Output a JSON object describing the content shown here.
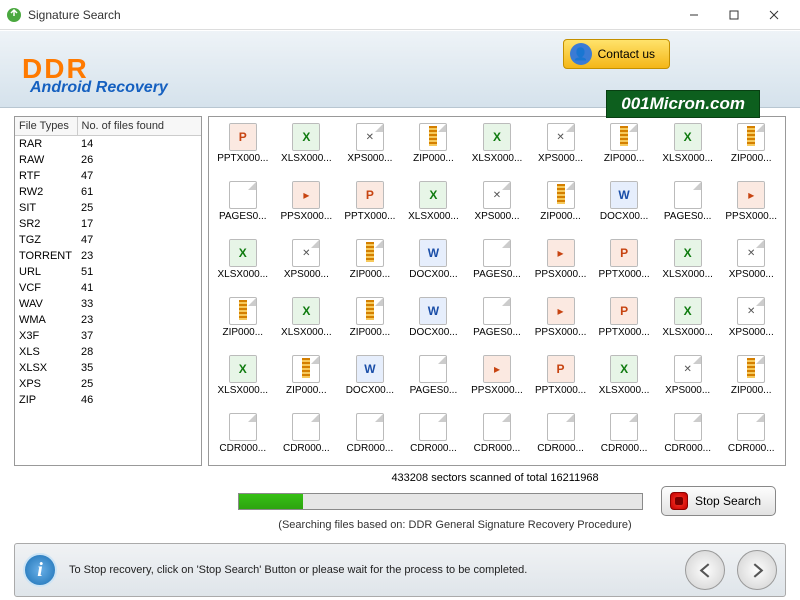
{
  "window": {
    "title": "Signature Search"
  },
  "header": {
    "brand": "DDR",
    "subtitle": "Android Recovery",
    "contact_label": "Contact us"
  },
  "watermark": "001Micron.com",
  "file_types": {
    "header_type": "File Types",
    "header_count": "No. of files found",
    "rows": [
      {
        "type": "RAR",
        "count": 14
      },
      {
        "type": "RAW",
        "count": 26
      },
      {
        "type": "RTF",
        "count": 47
      },
      {
        "type": "RW2",
        "count": 61
      },
      {
        "type": "SIT",
        "count": 25
      },
      {
        "type": "SR2",
        "count": 17
      },
      {
        "type": "TGZ",
        "count": 47
      },
      {
        "type": "TORRENT",
        "count": 23
      },
      {
        "type": "URL",
        "count": 51
      },
      {
        "type": "VCF",
        "count": 41
      },
      {
        "type": "WAV",
        "count": 33
      },
      {
        "type": "WMA",
        "count": 23
      },
      {
        "type": "X3F",
        "count": 37
      },
      {
        "type": "XLS",
        "count": 28
      },
      {
        "type": "XLSX",
        "count": 35
      },
      {
        "type": "XPS",
        "count": 25
      },
      {
        "type": "ZIP",
        "count": 46
      }
    ]
  },
  "found_files": [
    {
      "name": "PPTX000...",
      "kind": "pptx"
    },
    {
      "name": "XLSX000...",
      "kind": "xlsx"
    },
    {
      "name": "XPS000...",
      "kind": "xps"
    },
    {
      "name": "ZIP000...",
      "kind": "zip"
    },
    {
      "name": "XLSX000...",
      "kind": "xlsx"
    },
    {
      "name": "XPS000...",
      "kind": "xps"
    },
    {
      "name": "ZIP000...",
      "kind": "zip"
    },
    {
      "name": "XLSX000...",
      "kind": "xlsx"
    },
    {
      "name": "ZIP000...",
      "kind": "zip"
    },
    {
      "name": "PAGES0...",
      "kind": "pages"
    },
    {
      "name": "PPSX000...",
      "kind": "ppsx"
    },
    {
      "name": "PPTX000...",
      "kind": "pptx"
    },
    {
      "name": "XLSX000...",
      "kind": "xlsx"
    },
    {
      "name": "XPS000...",
      "kind": "xps"
    },
    {
      "name": "ZIP000...",
      "kind": "zip"
    },
    {
      "name": "DOCX00...",
      "kind": "docx"
    },
    {
      "name": "PAGES0...",
      "kind": "pages"
    },
    {
      "name": "PPSX000...",
      "kind": "ppsx"
    },
    {
      "name": "XLSX000...",
      "kind": "xlsx"
    },
    {
      "name": "XPS000...",
      "kind": "xps"
    },
    {
      "name": "ZIP000...",
      "kind": "zip"
    },
    {
      "name": "DOCX00...",
      "kind": "docx"
    },
    {
      "name": "PAGES0...",
      "kind": "pages"
    },
    {
      "name": "PPSX000...",
      "kind": "ppsx"
    },
    {
      "name": "PPTX000...",
      "kind": "pptx"
    },
    {
      "name": "XLSX000...",
      "kind": "xlsx"
    },
    {
      "name": "XPS000...",
      "kind": "xps"
    },
    {
      "name": "ZIP000...",
      "kind": "zip"
    },
    {
      "name": "XLSX000...",
      "kind": "xlsx"
    },
    {
      "name": "ZIP000...",
      "kind": "zip"
    },
    {
      "name": "DOCX00...",
      "kind": "docx"
    },
    {
      "name": "PAGES0...",
      "kind": "pages"
    },
    {
      "name": "PPSX000...",
      "kind": "ppsx"
    },
    {
      "name": "PPTX000...",
      "kind": "pptx"
    },
    {
      "name": "XLSX000...",
      "kind": "xlsx"
    },
    {
      "name": "XPS000...",
      "kind": "xps"
    },
    {
      "name": "XLSX000...",
      "kind": "xlsx"
    },
    {
      "name": "ZIP000...",
      "kind": "zip"
    },
    {
      "name": "DOCX00...",
      "kind": "docx"
    },
    {
      "name": "PAGES0...",
      "kind": "pages"
    },
    {
      "name": "PPSX000...",
      "kind": "ppsx"
    },
    {
      "name": "PPTX000...",
      "kind": "pptx"
    },
    {
      "name": "XLSX000...",
      "kind": "xlsx"
    },
    {
      "name": "XPS000...",
      "kind": "xps"
    },
    {
      "name": "ZIP000...",
      "kind": "zip"
    },
    {
      "name": "CDR000...",
      "kind": "blank"
    },
    {
      "name": "CDR000...",
      "kind": "blank"
    },
    {
      "name": "CDR000...",
      "kind": "blank"
    },
    {
      "name": "CDR000...",
      "kind": "blank"
    },
    {
      "name": "CDR000...",
      "kind": "blank"
    },
    {
      "name": "CDR000...",
      "kind": "blank"
    },
    {
      "name": "CDR000...",
      "kind": "blank"
    },
    {
      "name": "CDR000...",
      "kind": "blank"
    },
    {
      "name": "CDR000...",
      "kind": "blank"
    }
  ],
  "progress": {
    "status": "433208 sectors scanned of total 16211968",
    "searching": "(Searching files based on:  DDR General Signature Recovery Procedure)",
    "stop_label": "Stop Search"
  },
  "footer": {
    "hint": "To Stop recovery, click on 'Stop Search' Button or please wait for the process to be completed."
  }
}
